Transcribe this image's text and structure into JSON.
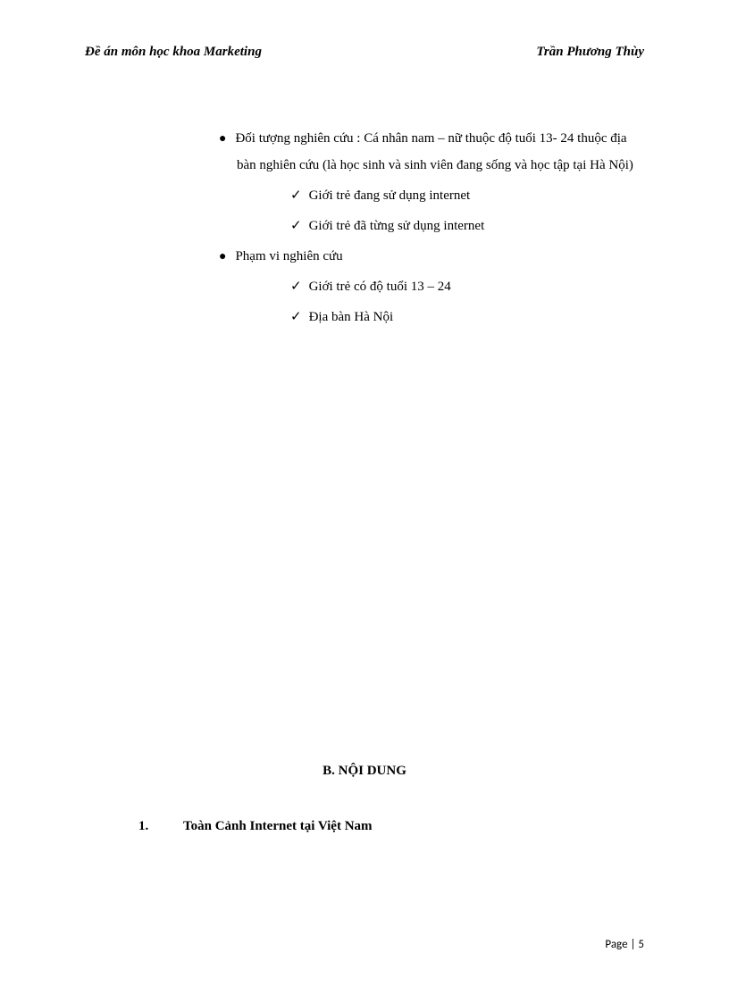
{
  "header": {
    "left": "Đề án môn học khoa Marketing",
    "right": "Trần Phương Thùy"
  },
  "bullets": {
    "item1": "Đối tượng nghiên cứu : Cá nhân nam – nữ thuộc độ tuổi 13- 24 thuộc địa bàn nghiên cứu (là học sinh và sinh viên đang sống và học tập tại Hà Nội)",
    "item1_sub1": "Giới trẻ đang sử dụng internet",
    "item1_sub2": "Giới trẻ đã từng sử dụng internet",
    "item2": "Phạm vi nghiên cứu",
    "item2_sub1": "Giới trẻ có độ tuổi 13 – 24",
    "item2_sub2": "Địa bàn Hà Nội"
  },
  "section": {
    "heading": "B. NỘI DUNG",
    "numbered": {
      "num": "1.",
      "text": "Toàn Cảnh Internet tại Việt Nam"
    }
  },
  "footer": {
    "text": "Page | 5"
  }
}
